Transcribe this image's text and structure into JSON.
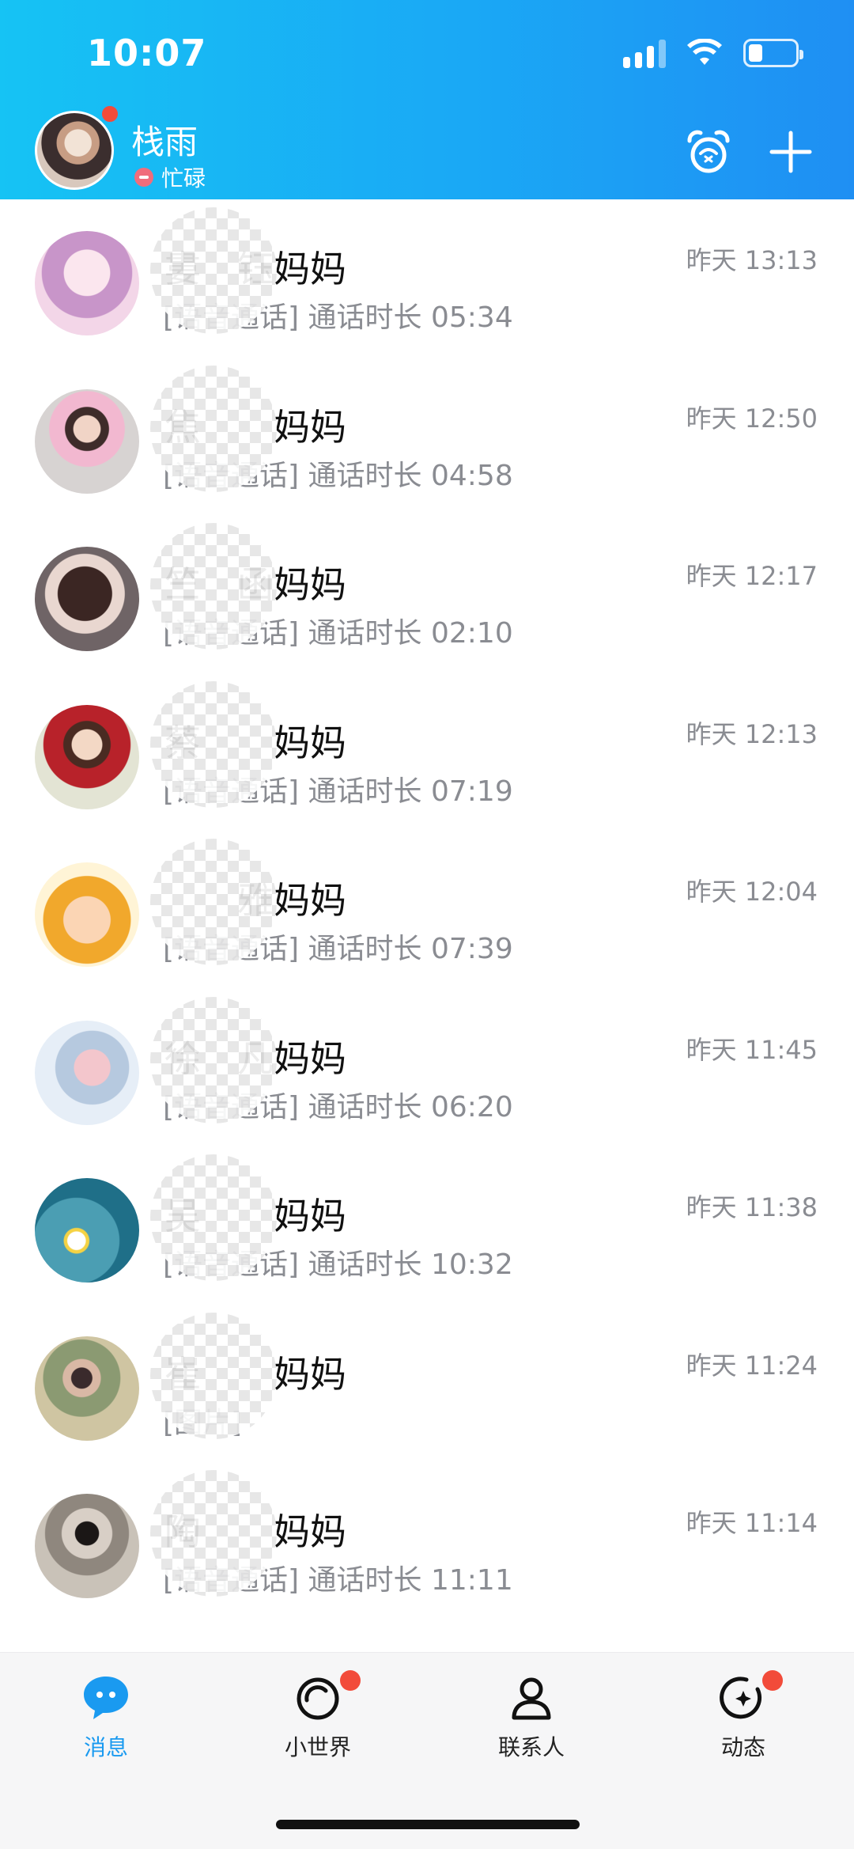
{
  "status_bar": {
    "time": "10:07",
    "icons": [
      "cellular-signal-icon",
      "wifi-icon",
      "battery-icon"
    ],
    "battery_level": 0.3
  },
  "header": {
    "user_name": "栈雨",
    "user_status": "忙碌",
    "status_color": "#f06d7c",
    "icons": [
      "alarm-clock-icon",
      "plus-icon"
    ],
    "gradient": [
      "#16c3f4",
      "#1f8ff3"
    ]
  },
  "messages": [
    {
      "name": "婁　钰妈妈",
      "preview": "[语音通话] 通话时长 05:34",
      "time": "昨天 13:13"
    },
    {
      "name": "焦　　妈妈",
      "preview": "[语音通话] 通话时长 04:58",
      "time": "昨天 12:50"
    },
    {
      "name": "竺　函妈妈",
      "preview": "[语音通话] 通话时长 02:10",
      "time": "昨天 12:17"
    },
    {
      "name": "蔡　　妈妈",
      "preview": "[语音通话] 通话时长 07:19",
      "time": "昨天 12:13"
    },
    {
      "name": "　　雅妈妈",
      "preview": "[语音通话] 通话时长 07:39",
      "time": "昨天 12:04"
    },
    {
      "name": "徐　凡妈妈",
      "preview": "[语音通话] 通话时长 06:20",
      "time": "昨天 11:45"
    },
    {
      "name": "吴　　妈妈",
      "preview": "[语音通话] 通话时长 10:32",
      "time": "昨天 11:38"
    },
    {
      "name": "崔　　妈妈",
      "preview": "[图片]",
      "time": "昨天 11:24"
    },
    {
      "name": "陶　　妈妈",
      "preview": "[语音通话] 通话时长 11:11",
      "time": "昨天 11:14"
    }
  ],
  "tabbar": {
    "tabs": [
      {
        "label": "消息",
        "icon": "message-bubble-icon",
        "active": true
      },
      {
        "label": "小世界",
        "icon": "small-world-icon",
        "badge": true
      },
      {
        "label": "联系人",
        "icon": "contacts-person-icon"
      },
      {
        "label": "动态",
        "icon": "moments-star-icon",
        "badge": true
      }
    ],
    "active_color": "#1a9af0",
    "badge_color": "#f24b3a"
  }
}
